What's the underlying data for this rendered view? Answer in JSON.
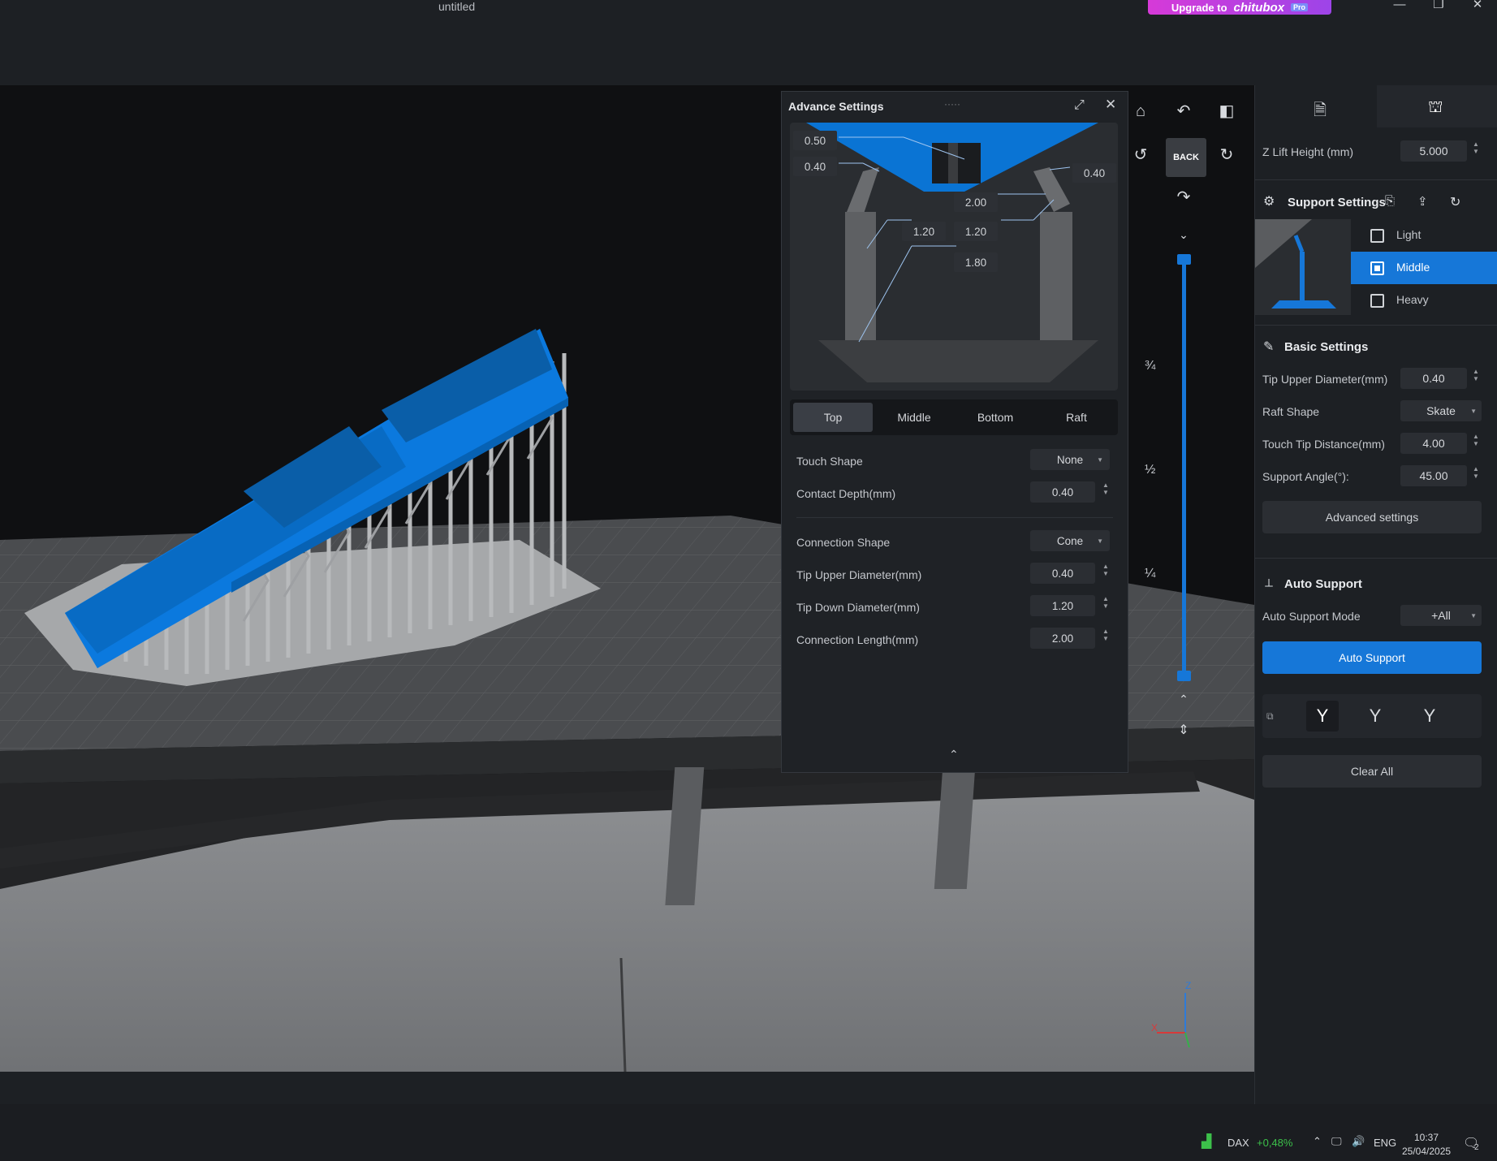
{
  "window": {
    "title": "untitled",
    "upgrade": {
      "prefix": "Upgrade to",
      "brand": "chitubox",
      "badge": "Pro"
    },
    "controls": {
      "minimize": "—",
      "restore": "❐",
      "close": "✕"
    }
  },
  "advance_panel": {
    "title": "Advance Settings",
    "handle": "·····",
    "diagram_labels": {
      "top_a": "0.50",
      "top_b": "0.40",
      "top_right": "0.40",
      "mid_a": "2.00",
      "mid_b": "1.20",
      "mid_c": "1.20",
      "mid_d": "1.80"
    },
    "tabs": [
      "Top",
      "Middle",
      "Bottom",
      "Raft"
    ],
    "active_tab": "Top",
    "rows": {
      "touch_shape": {
        "label": "Touch Shape",
        "value": "None"
      },
      "contact_depth": {
        "label": "Contact Depth(mm)",
        "value": "0.40"
      },
      "connection_shape": {
        "label": "Connection Shape",
        "value": "Cone"
      },
      "tip_upper": {
        "label": "Tip Upper Diameter(mm)",
        "value": "0.40"
      },
      "tip_down": {
        "label": "Tip Down Diameter(mm)",
        "value": "1.20"
      },
      "connection_length": {
        "label": "Connection Length(mm)",
        "value": "2.00"
      }
    },
    "collapse_glyph": "⌃"
  },
  "view_toolbar": {
    "back_label": "BACK",
    "ticks": [
      "¾",
      "½",
      "¼"
    ]
  },
  "right_panel": {
    "z_lift": {
      "label": "Z Lift Height (mm)",
      "value": "5.000"
    },
    "support_settings": {
      "title": "Support Settings",
      "presets": [
        {
          "label": "Light",
          "selected": false
        },
        {
          "label": "Middle",
          "selected": true
        },
        {
          "label": "Heavy",
          "selected": false
        }
      ]
    },
    "basic_settings": {
      "title": "Basic Settings",
      "tip_upper": {
        "label": "Tip Upper Diameter(mm)",
        "value": "0.40"
      },
      "raft_shape": {
        "label": "Raft Shape",
        "value": "Skate"
      },
      "touch_tip": {
        "label": "Touch Tip Distance(mm)",
        "value": "4.00"
      },
      "support_angle": {
        "label": "Support Angle(°):",
        "value": "45.00"
      },
      "advanced_button": "Advanced settings"
    },
    "auto_support": {
      "title": "Auto Support",
      "mode_label": "Auto Support Mode",
      "mode_value": "+All",
      "button": "Auto Support"
    },
    "clear_all": "Clear All"
  },
  "taskbar": {
    "ticker": "DAX",
    "change": "+0,48%",
    "lang": "ENG",
    "time": "10:37",
    "date": "25/04/2025",
    "notif_count": "2"
  },
  "colors": {
    "accent": "#1677d8",
    "model": "#0a74d4",
    "support": "#a9abad",
    "annotation": "#e0151b",
    "ticker_up": "#3cc04a"
  }
}
